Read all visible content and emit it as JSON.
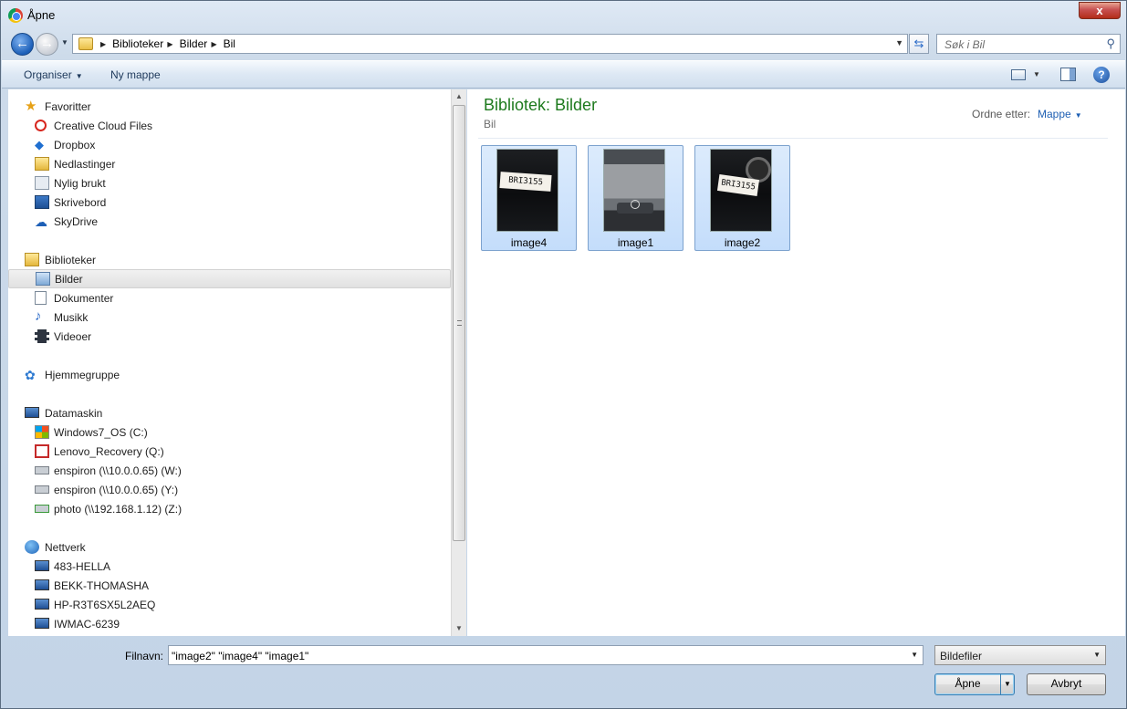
{
  "window": {
    "title": "Åpne",
    "close_label": "x"
  },
  "address": {
    "crumbs": [
      "Biblioteker",
      "Bilder",
      "Bil"
    ],
    "search_placeholder": "Søk i Bil"
  },
  "toolbar": {
    "organise_label": "Organiser",
    "new_folder_label": "Ny mappe"
  },
  "nav": {
    "favorites": {
      "header": "Favoritter",
      "items": [
        "Creative Cloud Files",
        "Dropbox",
        "Nedlastinger",
        "Nylig brukt",
        "Skrivebord",
        "SkyDrive"
      ]
    },
    "libraries": {
      "header": "Biblioteker",
      "items": [
        "Bilder",
        "Dokumenter",
        "Musikk",
        "Videoer"
      ],
      "selected": "Bilder"
    },
    "homegroup": {
      "header": "Hjemmegruppe"
    },
    "computer": {
      "header": "Datamaskin",
      "items": [
        "Windows7_OS (C:)",
        "Lenovo_Recovery (Q:)",
        "enspiron (\\\\10.0.0.65) (W:)",
        "enspiron (\\\\10.0.0.65) (Y:)",
        "photo (\\\\192.168.1.12) (Z:)"
      ]
    },
    "network": {
      "header": "Nettverk",
      "items": [
        "483-HELLA",
        "BEKK-THOMASHA",
        "HP-R3T6SX5L2AEQ",
        "IWMAC-6239"
      ]
    }
  },
  "content": {
    "title": "Bibliotek: Bilder",
    "subtitle": "Bil",
    "sort_label": "Ordne etter:",
    "sort_value": "Mappe",
    "files": [
      {
        "name": "image4",
        "note": "BRI3155",
        "kind": "dark"
      },
      {
        "name": "image1",
        "kind": "car"
      },
      {
        "name": "image2",
        "note": "BRI3155",
        "kind": "dark"
      }
    ]
  },
  "footer": {
    "filename_label": "Filnavn:",
    "filename_value": "\"image2\" \"image4\" \"image1\"",
    "filter_value": "Bildefiler",
    "open_label": "Åpne",
    "cancel_label": "Avbryt"
  },
  "colors": {
    "accent_title": "#1e7a1e",
    "link_blue": "#1e5fb3",
    "selection": "#c4ddfb"
  }
}
